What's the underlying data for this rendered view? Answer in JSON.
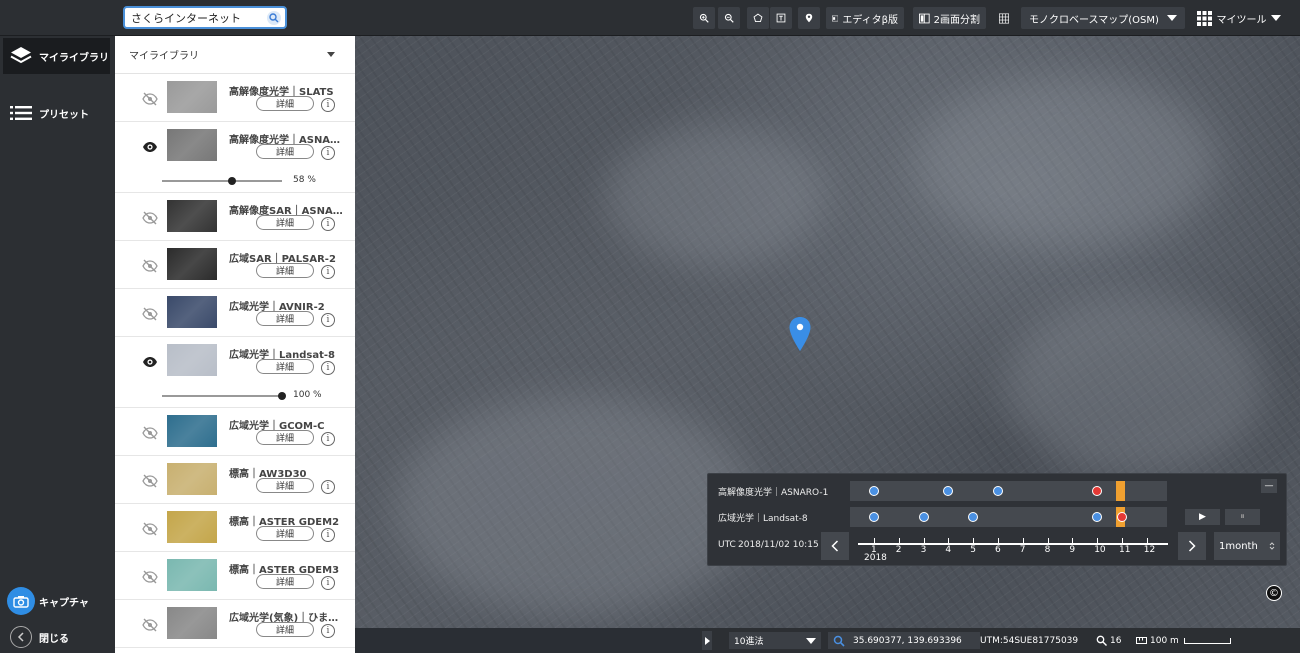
{
  "search": {
    "value": "さくらインターネット"
  },
  "toolbar": {
    "editor_label": "エディタβ版",
    "split_label": "2画面分割",
    "basemap_label": "モノクロベースマップ(OSM)",
    "mytool_label": "マイツール"
  },
  "nav": {
    "library_label": "マイライブラリ",
    "preset_label": "プリセット",
    "capture_label": "キャプチャ",
    "close_label": "閉じる"
  },
  "panel": {
    "header": "マイライブラリ",
    "detail_label": "詳細",
    "info_glyph": "i",
    "pct_unit": "%",
    "layers": [
      {
        "title": "高解像度光学｜SLATS",
        "visible": false,
        "thumb": "#9a9a9a"
      },
      {
        "title": "高解像度光学｜ASNA…",
        "visible": true,
        "thumb": "#777",
        "opacity": 58
      },
      {
        "title": "高解像度SAR｜ASNA…",
        "visible": false,
        "thumb": "#333"
      },
      {
        "title": "広域SAR｜PALSAR-2",
        "visible": false,
        "thumb": "#2b2b2b"
      },
      {
        "title": "広域光学｜AVNIR-2",
        "visible": false,
        "thumb": "#3a4a6a"
      },
      {
        "title": "広域光学｜Landsat-8",
        "visible": true,
        "thumb": "#b8bec8",
        "opacity": 100
      },
      {
        "title": "広域光学｜GCOM-C",
        "visible": false,
        "thumb": "#2e6e8e"
      },
      {
        "title": "標高｜AW3D30",
        "visible": false,
        "thumb": "#c8b070"
      },
      {
        "title": "標高｜ASTER GDEM2",
        "visible": false,
        "thumb": "#c4a64a"
      },
      {
        "title": "標高｜ASTER GDEM3",
        "visible": false,
        "thumb": "#7ab8b0"
      },
      {
        "title": "広域光学(気象)｜ひま…",
        "visible": false,
        "thumb": "#888"
      }
    ]
  },
  "timeline": {
    "rows": [
      {
        "label": "高解像度光学｜ASNARO-1",
        "dots": [
          {
            "m": 1,
            "c": "#4a90e2"
          },
          {
            "m": 4,
            "c": "#4a90e2"
          },
          {
            "m": 6,
            "c": "#4a90e2"
          },
          {
            "m": 10,
            "c": "#e53935"
          }
        ]
      },
      {
        "label": "広域光学｜Landsat-8",
        "dots": [
          {
            "m": 1,
            "c": "#4a90e2"
          },
          {
            "m": 3,
            "c": "#4a90e2"
          },
          {
            "m": 5,
            "c": "#4a90e2"
          },
          {
            "m": 10,
            "c": "#4a90e2"
          },
          {
            "m": 11,
            "c": "#e53935"
          }
        ]
      }
    ],
    "utc_label": "UTC",
    "datetime": "2018/11/02 10:15",
    "months": [
      "1",
      "2",
      "3",
      "4",
      "5",
      "6",
      "7",
      "8",
      "9",
      "10",
      "11",
      "12"
    ],
    "year": "2018",
    "interval": "1month",
    "play_glyph": "▶",
    "pause_glyph": "⏸",
    "minimize_glyph": "—"
  },
  "status": {
    "notation": "10進法",
    "coords": "35.690377, 139.693396",
    "utm": "UTM:54SUE81775039",
    "zoom": "16",
    "scale": "100 m"
  },
  "colors": {
    "accent": "#4a90d9",
    "bar": "#2c2f33",
    "marker": "#3a8ee6",
    "cursor": "#f0a030"
  },
  "credit_glyph": "©"
}
